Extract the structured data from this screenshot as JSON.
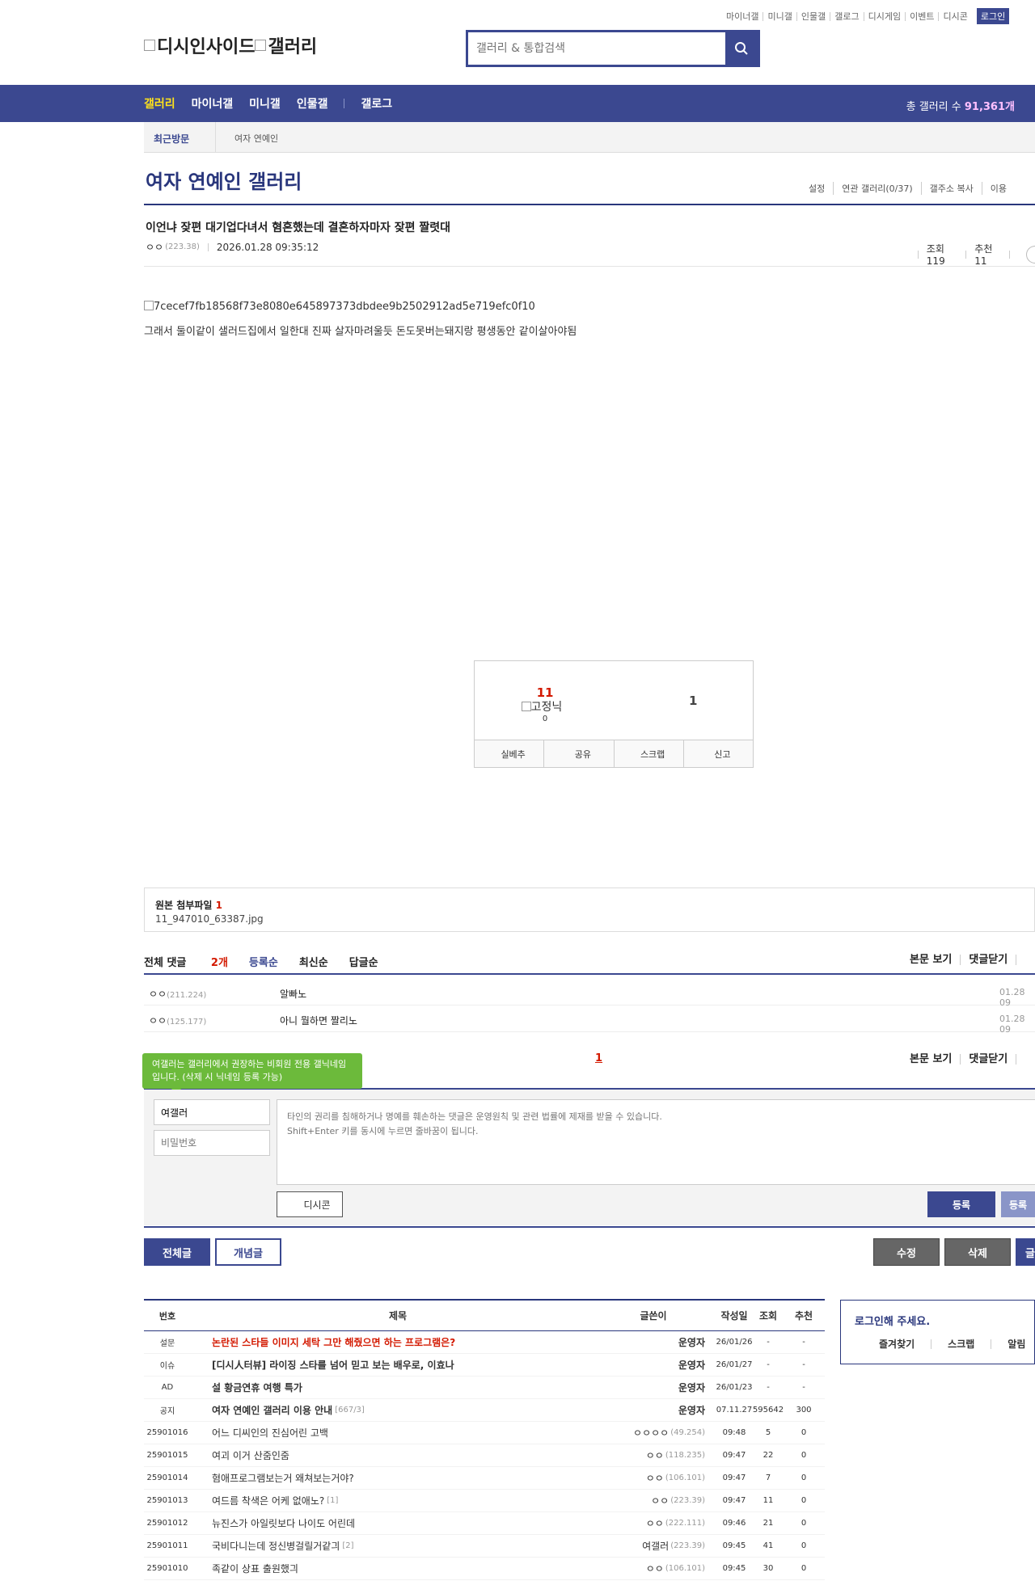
{
  "top_links": [
    "마이너갤",
    "미니갤",
    "인물갤",
    "갤로그",
    "디시게임",
    "이벤트",
    "디시콘"
  ],
  "login_label": "로그인",
  "logo": {
    "alt1": "디시인사이드",
    "alt2": "갤러리"
  },
  "search": {
    "placeholder": "갤러리 & 통합검색"
  },
  "nav": {
    "items": [
      "갤러리",
      "마이너갤",
      "미니갤",
      "인물갤",
      "갤로그"
    ],
    "count_prefix": "총 갤러리 수 ",
    "count_value": "91,361개"
  },
  "recent": {
    "label": "최근방문",
    "item": "여자 연예인"
  },
  "gallery": {
    "title": "여자 연예인 갤러리",
    "links": [
      "설정",
      "연관 갤러리(0/37)",
      "갤주소 복사",
      "이용"
    ]
  },
  "post": {
    "title": "이언냐 잦편 대기업다녀서 혐혼했는데 결혼하자마자 잦편 짤렷대",
    "author": "ㅇㅇ",
    "ip": "(223.38)",
    "date": "2026.01.28 09:35:12",
    "views": "조회 119",
    "recommends": "추천 11",
    "image_alt": "7cecef7fb18568f73e8080e645897373dbdee9b2502912ad5e719efc0f10",
    "body": "그래서 둘이같이 샐러드집에서 일한대 진짜 살자마려울듯 돈도못버는돼지랑 평생동안 같이살아야됨"
  },
  "recommend": {
    "up": "11",
    "fix_label": "고정닉",
    "fix_count": "0",
    "down": "1",
    "buttons": [
      "실베추",
      "공유",
      "스크랩",
      "신고"
    ]
  },
  "attachment": {
    "label": "원본 첨부파일",
    "count": "1",
    "filename": "11_947010_63387.jpg"
  },
  "comments": {
    "total_label": "전체 댓글",
    "total_count": "2개",
    "sorts": [
      "등록순",
      "최신순",
      "답글순"
    ],
    "right_links": [
      "본문 보기",
      "댓글닫기"
    ],
    "items": [
      {
        "nick": "ㅇㅇ",
        "ip": "(211.224)",
        "text": "알빠노",
        "date": "01.28 09"
      },
      {
        "nick": "ㅇㅇ",
        "ip": "(125.177)",
        "text": "아니 뭘하면 짤리노",
        "date": "01.28 09"
      }
    ],
    "page": "1"
  },
  "write": {
    "tooltip": "여갤러는 갤러리에서 권장하는 비회원 전용 갤닉네임입니다. (삭제 시 닉네임 등록 가능)",
    "nick_value": "여갤러",
    "password_placeholder": "비밀번호",
    "textarea_placeholder": "타인의 권리를 침해하거나 명예를 훼손하는 댓글은 운영원칙 및 관련 법률에 제재를 받을 수 있습니다.\nShift+Enter 키를 동시에 누르면 줄바꿈이 됩니다.",
    "dccon": "디시콘",
    "register": "등록",
    "register2": "등록"
  },
  "actions": {
    "all": "전체글",
    "concept": "개념글",
    "edit": "수정",
    "delete": "삭제",
    "write": "글"
  },
  "list": {
    "headers": [
      "번호",
      "제목",
      "글쓴이",
      "작성일",
      "조회",
      "추천"
    ],
    "rows": [
      {
        "num": "설문",
        "title": "논란된 스타들 이미지 세탁 그만 해줬으면 하는 프로그램은?",
        "writer": "운영자",
        "ip": "",
        "date": "26/01/26",
        "views": "-",
        "rec": "-",
        "red": true,
        "notice": true
      },
      {
        "num": "이슈",
        "title": "[디시人터뷰] 라이징 스타를 넘어 믿고 보는 배우로, 이효나",
        "writer": "운영자",
        "ip": "",
        "date": "26/01/27",
        "views": "-",
        "rec": "-",
        "notice": true
      },
      {
        "num": "AD",
        "title": "설 황금연휴 여행 특가",
        "writer": "운영자",
        "ip": "",
        "date": "26/01/23",
        "views": "-",
        "rec": "-",
        "notice": true
      },
      {
        "num": "공지",
        "title": "여자 연예인 갤러리 이용 안내",
        "cnt": "[667/3]",
        "writer": "운영자",
        "ip": "",
        "date": "07.11.27",
        "views": "595642",
        "rec": "300",
        "notice": true
      },
      {
        "num": "25901016",
        "title": "어느 디씨인의 진심어린 고백",
        "writer": "ㅇㅇㅇㅇ",
        "ip": "(49.254)",
        "date": "09:48",
        "views": "5",
        "rec": "0"
      },
      {
        "num": "25901015",
        "title": "여괴 이거 산줌인줌",
        "writer": "ㅇㅇ",
        "ip": "(118.235)",
        "date": "09:47",
        "views": "22",
        "rec": "0"
      },
      {
        "num": "25901014",
        "title": "혐애프로그램보는거 왜쳐보는거야?",
        "writer": "ㅇㅇ",
        "ip": "(106.101)",
        "date": "09:47",
        "views": "7",
        "rec": "0"
      },
      {
        "num": "25901013",
        "title": "여드름 착색은 어케 없애노?",
        "cnt": "[1]",
        "writer": "ㅇㅇ",
        "ip": "(223.39)",
        "date": "09:47",
        "views": "11",
        "rec": "0"
      },
      {
        "num": "25901012",
        "title": "뉴진스가 아일릿보다 나이도 어린데",
        "writer": "ㅇㅇ",
        "ip": "(222.111)",
        "date": "09:46",
        "views": "21",
        "rec": "0"
      },
      {
        "num": "25901011",
        "title": "국비다니는데 정신병걸릴거같긔",
        "cnt": "[2]",
        "writer": "여갤러",
        "ip": "(223.39)",
        "date": "09:45",
        "views": "41",
        "rec": "0"
      },
      {
        "num": "25901010",
        "title": "족같이 상표 출원했긔",
        "writer": "ㅇㅇ",
        "ip": "(106.101)",
        "date": "09:45",
        "views": "30",
        "rec": "0"
      }
    ]
  },
  "login_box": {
    "title": "로그인해 주세요.",
    "links": [
      "즐겨찾기",
      "스크랩",
      "알림"
    ]
  }
}
